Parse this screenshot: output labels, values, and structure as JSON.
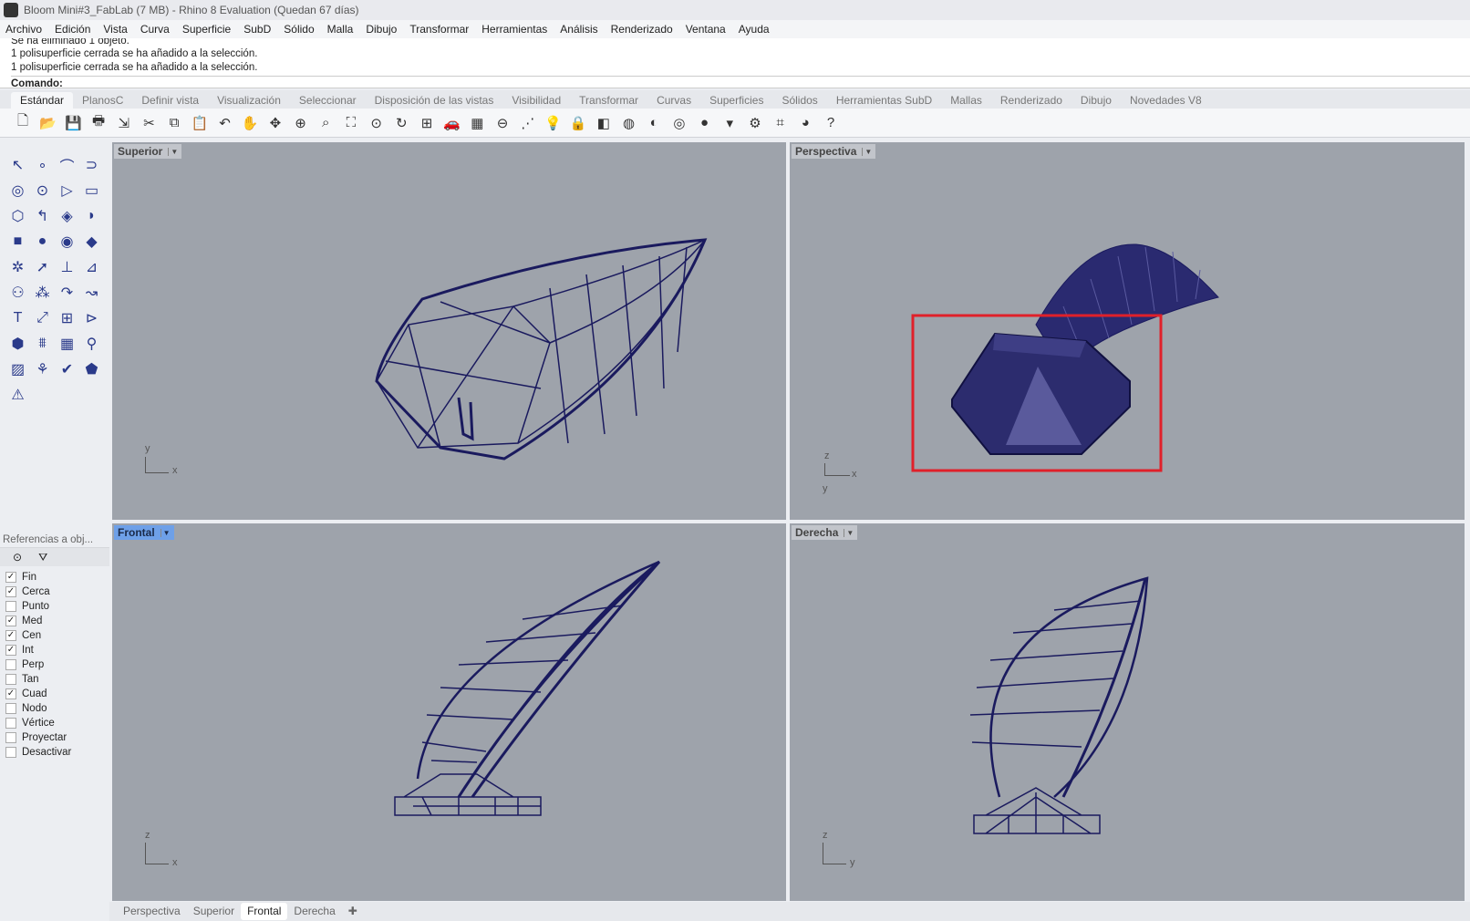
{
  "window": {
    "title": "Bloom Mini#3_FabLab (7 MB) - Rhino 8 Evaluation (Quedan 67 días)"
  },
  "menu": [
    "Archivo",
    "Edición",
    "Vista",
    "Curva",
    "Superficie",
    "SubD",
    "Sólido",
    "Malla",
    "Dibujo",
    "Transformar",
    "Herramientas",
    "Análisis",
    "Renderizado",
    "Ventana",
    "Ayuda"
  ],
  "command": {
    "history": [
      "Se ha eliminado 1 objeto.",
      "1 polisuperficie cerrada se ha añadido a la selección.",
      "1 polisuperficie cerrada se ha añadido a la selección."
    ],
    "prompt": "Comando:"
  },
  "toolbar_tabs": [
    "Estándar",
    "PlanosC",
    "Definir vista",
    "Visualización",
    "Seleccionar",
    "Disposición de las vistas",
    "Visibilidad",
    "Transformar",
    "Curvas",
    "Superficies",
    "Sólidos",
    "Herramientas SubD",
    "Mallas",
    "Renderizado",
    "Dibujo",
    "Novedades V8"
  ],
  "toolbar_icons": [
    "new-icon",
    "open-icon",
    "save-icon",
    "print-icon",
    "import-icon",
    "cut-icon",
    "copy-icon",
    "paste-icon",
    "undo-icon",
    "pan-icon",
    "rotate-view-icon",
    "zoom-icon",
    "zoom-window-icon",
    "zoom-extents-icon",
    "zoom-selected-icon",
    "rotate-icon",
    "four-viewports-icon",
    "car-icon",
    "grid-icon",
    "select-icon",
    "point-icon",
    "light-icon",
    "lock-icon",
    "layer-icon",
    "color-wheel-icon",
    "material-icon",
    "render-icon",
    "sphere-icon",
    "render-tool-icon",
    "settings-icon",
    "osnap-icon",
    "globe-icon",
    "help-icon"
  ],
  "tools": [
    "↖",
    "∘",
    "⌒",
    "⊃",
    "◎",
    "⊙",
    "▷",
    "▭",
    "⬡",
    "↰",
    "◈",
    "◗",
    "■",
    "●",
    "◉",
    "◆",
    "✲",
    "➚",
    "⊥",
    "⊿",
    "⚇",
    "⁂",
    "↷",
    "↝",
    "T",
    "⤢",
    "⊞",
    "⊳",
    "⬢",
    "⩩",
    "▦",
    "⚲",
    "▨",
    "⚘",
    "✔",
    "⬟",
    "⚠"
  ],
  "osnap": {
    "header": "Referencias a obj...",
    "items": [
      {
        "label": "Fin",
        "checked": true
      },
      {
        "label": "Cerca",
        "checked": true
      },
      {
        "label": "Punto",
        "checked": false
      },
      {
        "label": "Med",
        "checked": true
      },
      {
        "label": "Cen",
        "checked": true
      },
      {
        "label": "Int",
        "checked": true
      },
      {
        "label": "Perp",
        "checked": false
      },
      {
        "label": "Tan",
        "checked": false
      },
      {
        "label": "Cuad",
        "checked": true
      },
      {
        "label": "Nodo",
        "checked": false
      },
      {
        "label": "Vértice",
        "checked": false
      },
      {
        "label": "Proyectar",
        "checked": false
      },
      {
        "label": "Desactivar",
        "checked": false
      }
    ]
  },
  "viewports": {
    "top": {
      "title": "Superior",
      "axes": [
        "y",
        "x"
      ]
    },
    "perspective": {
      "title": "Perspectiva",
      "axes": [
        "z",
        "x",
        "y"
      ]
    },
    "front": {
      "title": "Frontal",
      "axes": [
        "z",
        "x"
      ]
    },
    "right": {
      "title": "Derecha",
      "axes": [
        "z",
        "y"
      ]
    }
  },
  "bottom_tabs": [
    "Perspectiva",
    "Superior",
    "Frontal",
    "Derecha"
  ],
  "active_tab": "Frontal",
  "colors": {
    "viewport_bg": "#9ea3ab",
    "wire": "#1a1a5e",
    "selection_box": "#e0202a",
    "active_viewport": "#6ea0e8"
  }
}
